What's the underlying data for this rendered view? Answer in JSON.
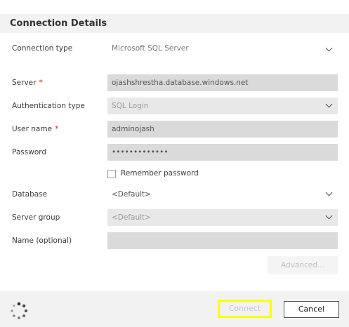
{
  "header": {
    "title": "Connection Details"
  },
  "form": {
    "connection_type": {
      "label": "Connection type",
      "value": "Microsoft SQL Server"
    },
    "server": {
      "label": "Server",
      "required_mark": "*",
      "value": "ojashshrestha.database.windows.net"
    },
    "auth_type": {
      "label": "Authentication type",
      "value": "SQL Login"
    },
    "user_name": {
      "label": "User name",
      "required_mark": "*",
      "value": "adminojash"
    },
    "password": {
      "label": "Password",
      "value": "•••••••••••••"
    },
    "remember_password": {
      "label": "Remember password",
      "checked": false
    },
    "database": {
      "label": "Database",
      "value": "<Default>"
    },
    "server_group": {
      "label": "Server group",
      "value": "<Default>"
    },
    "name_optional": {
      "label": "Name (optional)",
      "value": ""
    },
    "advanced_label": "Advanced..."
  },
  "footer": {
    "connect_label": "Connect",
    "cancel_label": "Cancel"
  },
  "colors": {
    "highlight": "#ffff00",
    "required": "#e51400",
    "field_bg": "#dadada",
    "panel_bg": "#f2f2f2"
  },
  "icons": {
    "spinner": "loading-spinner-icon",
    "dropdown": "chevron-down-icon"
  }
}
